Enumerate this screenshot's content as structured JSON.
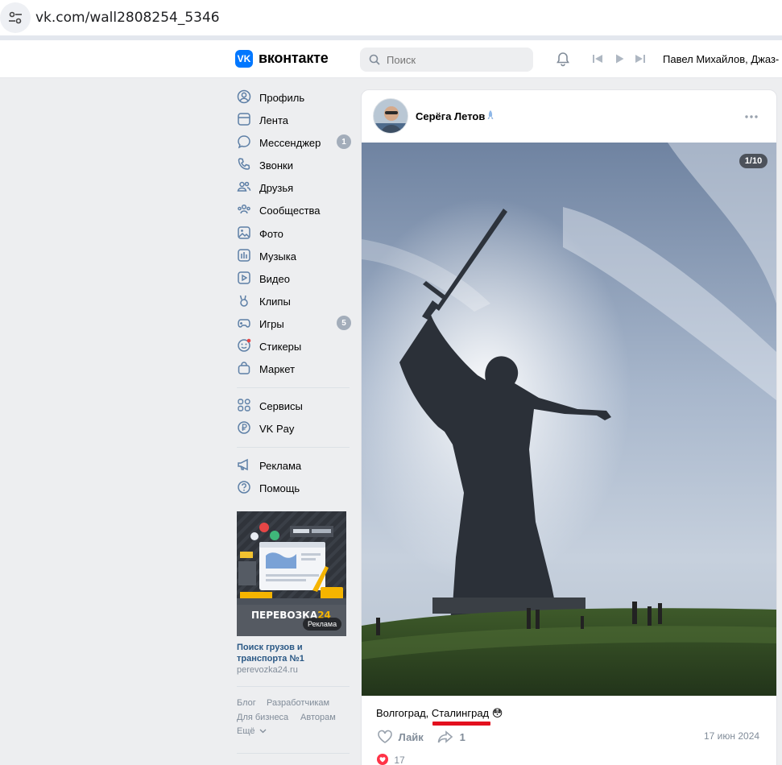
{
  "browser": {
    "url": "vk.com/wall2808254_5346"
  },
  "header": {
    "logo_mark": "VK",
    "logo_text": "вконтакте",
    "search_placeholder": "Поиск",
    "now_playing": "Павел Михайлов, Джаз-"
  },
  "nav": {
    "items": [
      {
        "label": "Профиль",
        "icon": "user-circle-icon"
      },
      {
        "label": "Лента",
        "icon": "newsfeed-icon"
      },
      {
        "label": "Мессенджер",
        "icon": "message-icon",
        "badge": "1"
      },
      {
        "label": "Звонки",
        "icon": "phone-icon"
      },
      {
        "label": "Друзья",
        "icon": "friends-icon"
      },
      {
        "label": "Сообщества",
        "icon": "communities-icon"
      },
      {
        "label": "Фото",
        "icon": "photo-icon"
      },
      {
        "label": "Музыка",
        "icon": "music-icon"
      },
      {
        "label": "Видео",
        "icon": "video-icon"
      },
      {
        "label": "Клипы",
        "icon": "clips-icon"
      },
      {
        "label": "Игры",
        "icon": "gamepad-icon",
        "badge": "5"
      },
      {
        "label": "Стикеры",
        "icon": "sticker-icon"
      },
      {
        "label": "Маркет",
        "icon": "market-bag-icon"
      }
    ],
    "services": [
      {
        "label": "Сервисы",
        "icon": "services-grid-icon"
      },
      {
        "label": "VK Pay",
        "icon": "vkpay-icon"
      }
    ],
    "extra": [
      {
        "label": "Реклама",
        "icon": "megaphone-icon"
      },
      {
        "label": "Помощь",
        "icon": "help-icon"
      }
    ]
  },
  "ad": {
    "brand": "ПЕРЕВОЗКА",
    "brand_num": "24",
    "badge": "Реклама",
    "title": "Поиск грузов и транспорта №1",
    "url": "perevozka24.ru"
  },
  "footer": {
    "links": [
      "Блог",
      "Разработчикам",
      "Для бизнеса",
      "Авторам"
    ],
    "more": "Ещё"
  },
  "post": {
    "author": "Серёга Летов",
    "counter": "1/10",
    "caption_prefix": "Волгоград, ",
    "caption_highlight": "Сталинград",
    "caption_emoji": "😳",
    "like_label": "Лайк",
    "share_count": "1",
    "date": "17 июн 2024",
    "reaction_count": "17"
  },
  "colors": {
    "accent": "#0077ff",
    "badge": "#a3adba",
    "highlight": "#e3101e"
  }
}
